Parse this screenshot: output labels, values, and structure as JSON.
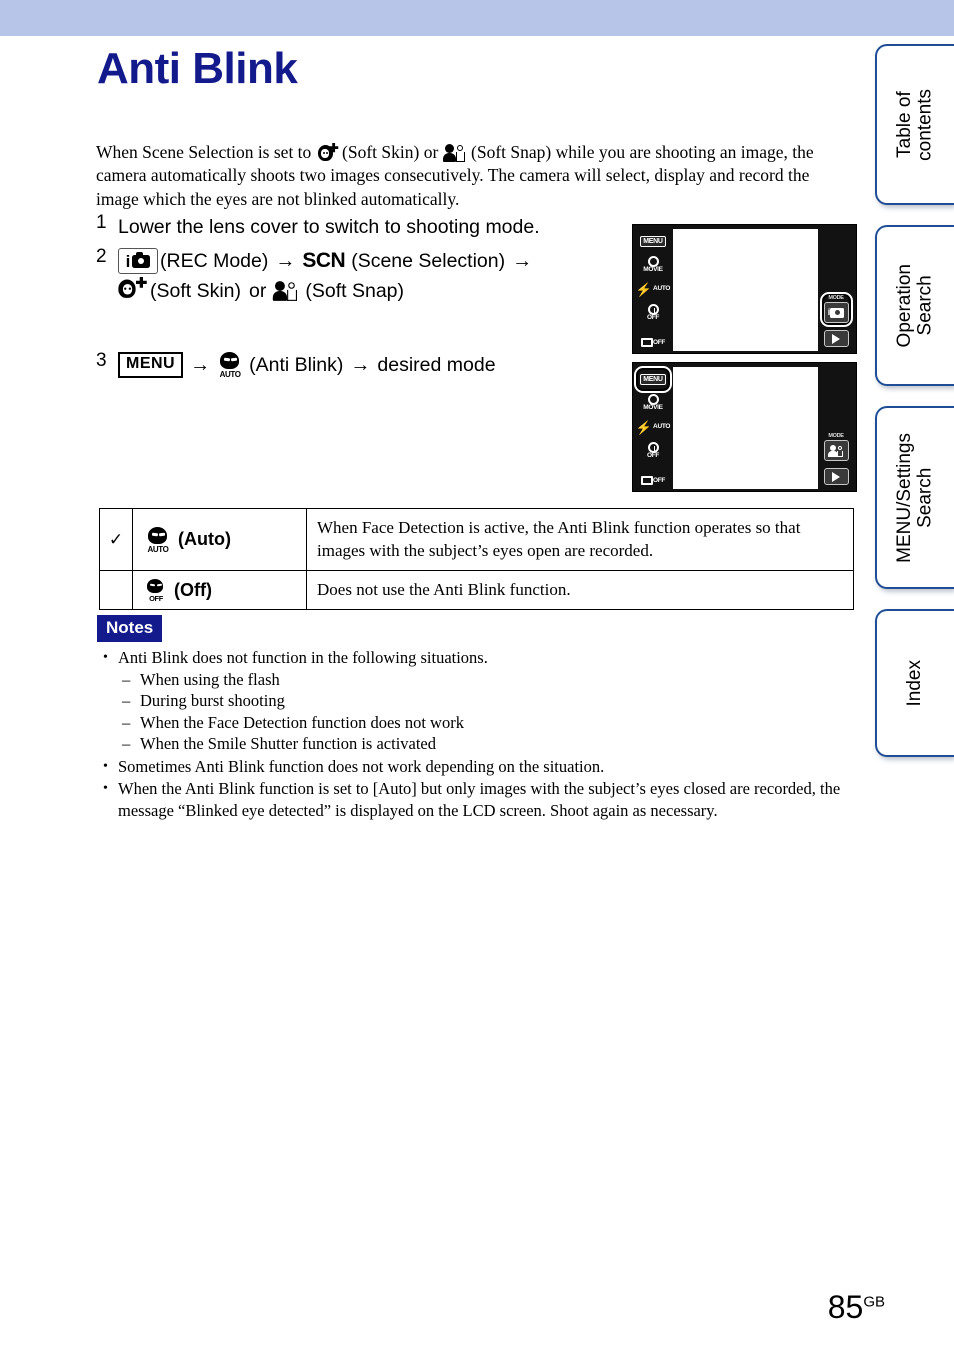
{
  "header": {
    "band_color": "#b7c6e8"
  },
  "page_title": "Anti Blink",
  "title_color": "#131a8c",
  "intro": {
    "part1": "When Scene Selection is set to",
    "icon1": "soft-skin-icon",
    "part2": "(Soft Skin) or",
    "icon2": "soft-snap-icon",
    "part3": "(Soft Snap) while you are shooting an image, the camera automatically shoots two images consecutively. The camera will select, display and record the image which the eyes are not blinked automatically."
  },
  "steps": [
    {
      "number": "1",
      "text": "Lower the lens cover to switch to shooting mode."
    },
    {
      "number": "2",
      "rec_icon_label": "i",
      "rec_label": "(REC Mode)",
      "arrow": "→",
      "scn_label": "SCN",
      "scene_label": "(Scene Selection)",
      "arrow2": "→",
      "soft_skin_label": "(Soft Skin)",
      "or_label": "or",
      "soft_snap_label": "(Soft Snap)"
    },
    {
      "number": "3",
      "menu_label": "MENU",
      "arrow": "→",
      "blink_caption": "AUTO",
      "anti_blink_label": "(Anti Blink)",
      "arrow2": "→",
      "desired_label": "desired mode"
    }
  ],
  "camera_screens": [
    {
      "name": "rec-mode-screen",
      "left_rail": [
        {
          "type": "menu",
          "label": "MENU"
        },
        {
          "type": "movie",
          "label": "MOVIE"
        },
        {
          "type": "flash",
          "label": "AUTO"
        },
        {
          "type": "timer",
          "label": "OFF"
        },
        {
          "type": "burst",
          "label": "OFF"
        }
      ],
      "mode_caption": "MODE",
      "mode_icon": "rec-mode-icon",
      "mode_highlighted": true,
      "menu_highlighted": false,
      "play_icon": "playback-icon"
    },
    {
      "name": "menu-screen",
      "left_rail": [
        {
          "type": "menu",
          "label": "MENU"
        },
        {
          "type": "movie",
          "label": "MOVIE"
        },
        {
          "type": "flash",
          "label": "AUTO"
        },
        {
          "type": "timer",
          "label": "OFF"
        },
        {
          "type": "burst",
          "label": "OFF"
        }
      ],
      "mode_caption": "MODE",
      "mode_icon": "soft-snap-mode-icon",
      "mode_highlighted": false,
      "menu_highlighted": true,
      "play_icon": "playback-icon"
    }
  ],
  "options_table": {
    "rows": [
      {
        "checked": "✓",
        "icon_caption": "AUTO",
        "label": "(Auto)",
        "description": "When Face Detection is active, the Anti Blink function operates so that images with the subject’s eyes open are recorded."
      },
      {
        "checked": "",
        "icon_caption": "OFF",
        "label": "(Off)",
        "description": "Does not use the Anti Blink function."
      }
    ]
  },
  "notes": {
    "badge": "Notes",
    "badge_color": "#131a8c",
    "items": [
      {
        "text": "Anti Blink does not function in the following situations.",
        "sub": [
          "When using the flash",
          "During burst shooting",
          "When the Face Detection function does not work",
          "When the Smile Shutter function is activated"
        ]
      },
      {
        "text": "Sometimes Anti Blink function does not work depending on the situation.",
        "sub": []
      },
      {
        "text": "When the Anti Blink function is set to [Auto] but only images with the subject’s eyes closed are recorded, the message “Blinked eye detected” is displayed on the LCD screen. Shoot again as necessary.",
        "sub": []
      }
    ]
  },
  "side_tabs": [
    {
      "label": "Table of\ncontents"
    },
    {
      "label": "Operation\nSearch"
    },
    {
      "label": "MENU/Settings\nSearch"
    },
    {
      "label": "Index"
    }
  ],
  "page_number": {
    "value": "85",
    "suffix": "GB"
  }
}
